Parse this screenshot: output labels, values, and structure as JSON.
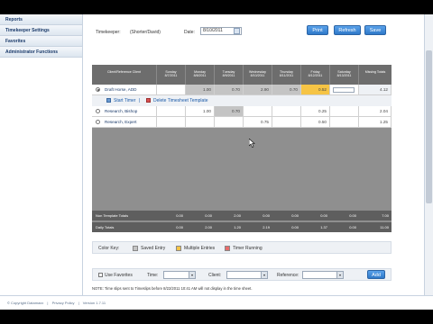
{
  "sidebar": {
    "items": [
      {
        "label": "Reports"
      },
      {
        "label": "Timekeeper Settings"
      },
      {
        "label": "Favorites"
      },
      {
        "label": "Administrator Functions"
      }
    ]
  },
  "header": {
    "timekeeper_label": "Timekeeper:",
    "timekeeper_value": "(Shorter/David)",
    "date_label": "Date:",
    "date_value": "8/10/2011",
    "print_label": "Print",
    "refresh_label": "Refresh",
    "save_label": "Save"
  },
  "grid": {
    "columns": [
      {
        "l1": "Client/Reference Client",
        "l2": ""
      },
      {
        "l1": "Sunday",
        "l2": "8/7/2011"
      },
      {
        "l1": "Monday",
        "l2": "8/8/2011"
      },
      {
        "l1": "Tuesday",
        "l2": "8/9/2011"
      },
      {
        "l1": "Wednesday",
        "l2": "8/10/2011"
      },
      {
        "l1": "Thursday",
        "l2": "8/11/2011"
      },
      {
        "l1": "Friday",
        "l2": "8/12/2011"
      },
      {
        "l1": "Saturday",
        "l2": "8/13/2011"
      },
      {
        "l1": "Missing Totals",
        "l2": ""
      }
    ],
    "rows": [
      {
        "name": "Draft Horse, ADD",
        "cells": [
          "",
          "1.00",
          "0.70",
          "2.90",
          "0.70",
          "0.52",
          "",
          "4.12"
        ]
      },
      {
        "name": "Research, Bishop",
        "cells": [
          "",
          "1.00",
          "0.70",
          "",
          "",
          "0.25",
          "",
          "2.04"
        ]
      },
      {
        "name": "Research, Expert",
        "cells": [
          "",
          "",
          "",
          "0.75",
          "",
          "0.50",
          "",
          "1.25"
        ]
      }
    ],
    "start_timer_label": "Start Timer",
    "separator": "|",
    "delete_label": "Delete Timesheet Template",
    "totals": [
      {
        "label": "Non Template Totals",
        "values": [
          "0.00",
          "0.00",
          "2.00",
          "0.00",
          "0.00",
          "0.00",
          "0.00",
          "7.00"
        ]
      },
      {
        "label": "Daily Totals",
        "values": [
          "0.00",
          "2.00",
          "1.20",
          "2.19",
          "0.00",
          "1.37",
          "0.00",
          "11.00"
        ]
      }
    ]
  },
  "legend": {
    "title": "Color Key:",
    "items": [
      {
        "label": "Saved Entry",
        "color": "#c4c4c4"
      },
      {
        "label": "Multiple Entries",
        "color": "#f6c445"
      },
      {
        "label": "Timer Running",
        "color": "#e86b6b"
      }
    ]
  },
  "add_bar": {
    "use_favorites_label": "Use Favorites",
    "time_label": "Time:",
    "client_label": "Client:",
    "reference_label": "Reference:",
    "add_label": "Add"
  },
  "note": "NOTE: Time slips sent to Timeslips before 8/22/2011 10:41 AM will not display in the time sheet.",
  "footer": {
    "copyright": "© Copyright Datamaxx",
    "privacy": "Privacy Policy",
    "version": "Version 1.7.11"
  },
  "colors": {
    "accent": "#2f79c9",
    "sidebar_text": "#1a3a6a"
  }
}
